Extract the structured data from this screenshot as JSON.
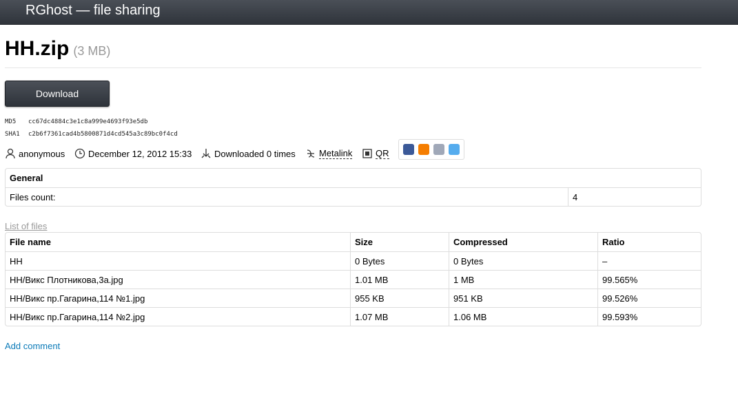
{
  "site": {
    "title": "RGhost — file sharing"
  },
  "file": {
    "name": "HH.zip",
    "size": "(3 MB)"
  },
  "download": {
    "label": "Download"
  },
  "hashes": [
    {
      "label": "MD5",
      "value": "cc67dc4884c3e1c8a999e4693f93e5db"
    },
    {
      "label": "SHA1",
      "value": "c2b6f7361cad4b5800871d4cd545a3c89bc0f4cd"
    }
  ],
  "meta": {
    "user": "anonymous",
    "date": "December 12, 2012 15:33",
    "downloads": "Downloaded 0 times",
    "metalink": "Metalink",
    "qr": "QR"
  },
  "social": [
    {
      "name": "facebook-icon",
      "color": "#3b5998"
    },
    {
      "name": "blogger-icon",
      "color": "#f57d00"
    },
    {
      "name": "livejournal-icon",
      "color": "#a0a8b8"
    },
    {
      "name": "twitter-icon",
      "color": "#55acee"
    }
  ],
  "general": {
    "header": "General",
    "files_count_label": "Files count:",
    "files_count_value": "4"
  },
  "list": {
    "title": "List of files",
    "columns": [
      "File name",
      "Size",
      "Compressed",
      "Ratio"
    ],
    "rows": [
      [
        "HH",
        "0 Bytes",
        "0 Bytes",
        "–"
      ],
      [
        "HH/Викс Плотникова,3а.jpg",
        "1.01 MB",
        "1 MB",
        "99.565%"
      ],
      [
        "HH/Викс пр.Гагарина,114 №1.jpg",
        "955 KB",
        "951 KB",
        "99.526%"
      ],
      [
        "HH/Викс пр.Гагарина,114 №2.jpg",
        "1.07 MB",
        "1.06 MB",
        "99.593%"
      ]
    ]
  },
  "comment": {
    "label": "Add comment"
  }
}
